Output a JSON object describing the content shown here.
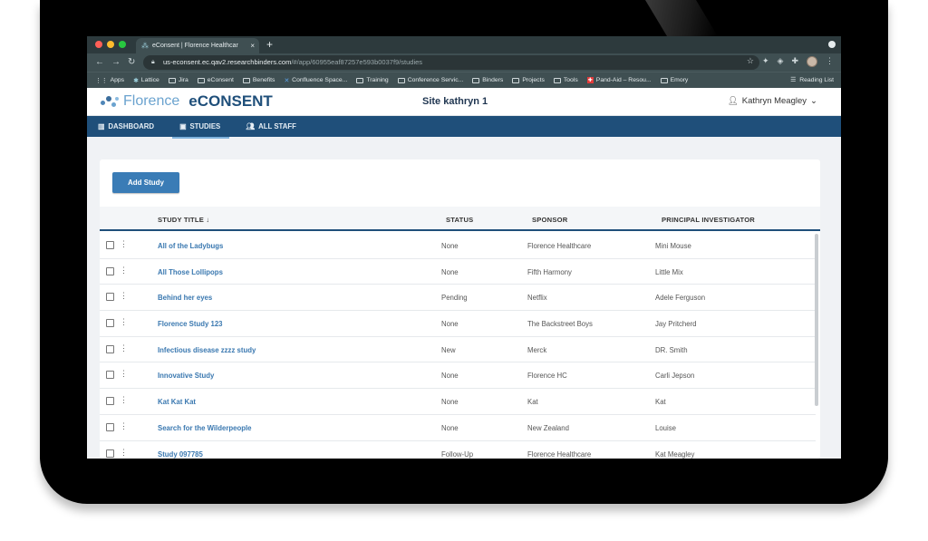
{
  "browser": {
    "tab_title": "eConsent | Florence Healthcar",
    "tab_close": "×",
    "new_tab": "+",
    "url_host": "us-econsent.ec.qav2.researchbinders.com",
    "url_path": "/#/app/60955eaf87257e593b0037f9/studies",
    "bookmarks": [
      {
        "label": "Apps"
      },
      {
        "label": "Lattice"
      },
      {
        "label": "Jira"
      },
      {
        "label": "eConsent"
      },
      {
        "label": "Benefits"
      },
      {
        "label": "Confluence Space..."
      },
      {
        "label": "Training"
      },
      {
        "label": "Conference Servic..."
      },
      {
        "label": "Binders"
      },
      {
        "label": "Projects"
      },
      {
        "label": "Tools"
      },
      {
        "label": "Pand-Aid – Resou..."
      },
      {
        "label": "Emory"
      }
    ],
    "reading_list": "Reading List"
  },
  "header": {
    "logo_florence": "Florence",
    "logo_econsent": "eCONSENT",
    "site_title": "Site kathryn 1",
    "user_name": "Kathryn Meagley"
  },
  "nav": {
    "dashboard": "DASHBOARD",
    "studies": "STUDIES",
    "all_staff": "ALL STAFF"
  },
  "toolbar": {
    "add_study": "Add Study"
  },
  "table": {
    "columns": {
      "title": "STUDY TITLE",
      "status": "STATUS",
      "sponsor": "SPONSOR",
      "pi": "PRINCIPAL INVESTIGATOR"
    },
    "rows": [
      {
        "title": "All of the Ladybugs",
        "status": "None",
        "sponsor": "Florence Healthcare",
        "pi": "Mini Mouse"
      },
      {
        "title": "All Those Lollipops",
        "status": "None",
        "sponsor": "Fifth Harmony",
        "pi": "Little Mix"
      },
      {
        "title": "Behind her eyes",
        "status": "Pending",
        "sponsor": "Netflix",
        "pi": "Adele Ferguson"
      },
      {
        "title": "Florence Study 123",
        "status": "None",
        "sponsor": "The Backstreet Boys",
        "pi": "Jay Pritcherd"
      },
      {
        "title": "Infectious disease zzzz study",
        "status": "New",
        "sponsor": "Merck",
        "pi": "DR. Smith"
      },
      {
        "title": "Innovative Study",
        "status": "None",
        "sponsor": "Florence HC",
        "pi": "Carli Jepson"
      },
      {
        "title": "Kat Kat Kat",
        "status": "None",
        "sponsor": "Kat",
        "pi": "Kat"
      },
      {
        "title": "Search for the Wilderpeople",
        "status": "None",
        "sponsor": "New Zealand",
        "pi": "Louise"
      },
      {
        "title": "Study 097785",
        "status": "Follow-Up",
        "sponsor": "Florence Healthcare",
        "pi": "Kat Meagley"
      }
    ]
  },
  "colors": {
    "brand_navy": "#1f4f7a",
    "link_blue": "#3a78b0",
    "button_blue": "#3a7cb6"
  }
}
